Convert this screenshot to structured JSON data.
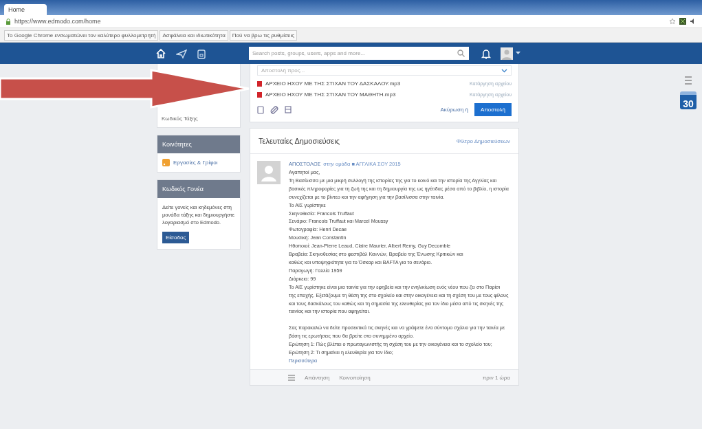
{
  "browser": {
    "tab_title": "Home",
    "address": "https://www.edmodo.com/home",
    "bookmarks": [
      "Το Google Chrome ενσωματώνει τον καλύτερο φυλλομετρητή",
      "Ασφάλεια και ιδιωτικότητα",
      "Πού να βρω τις ρυθμίσεις"
    ]
  },
  "navbar": {
    "search": {
      "placeholder": "Search posts, groups, users, apps and more..."
    }
  },
  "composer": {
    "recipient_placeholder": "Αποστολή προς...",
    "attachments": [
      {
        "name": "ΑΡΧΕΙΟ ΗΧΟΥ ΜΕ ΤΗΣ ΣΤΙΧΑΝ ΤΟΥ ΔΑΣΚΑΛΟΥ.mp3",
        "action": "Κατάργηση αρχείου"
      },
      {
        "name": "ΑΡΧΕΙΟ ΗΧΟΥ ΜΕ ΤΗΣ ΣΤΙΧΑΝ ΤΟΥ ΜΑΘΗΤΗ.mp3",
        "action": "Κατάργηση αρχείου"
      }
    ],
    "cancel": "Ακύρωση ή",
    "send": "Αποστολή"
  },
  "sidebar": {
    "top_item": "Κωδικός Τάξης",
    "sections": [
      {
        "title": "Κοινότητες",
        "link": "Εργασίες & Γρίφοι"
      },
      {
        "title": "Κωδικός Γονέα",
        "text": "Δείτε γονείς και κηδεμόνες στη μονάδα τάξης και δημιουργήστε λογαριασμό στο Edmodo.",
        "button": "Είσοδος"
      }
    ]
  },
  "feed": {
    "title": "Τελευταίες Δημοσιεύσεις",
    "filter": "Φίλτρο Δημοσιεύσεων",
    "post": {
      "author": "ΑΠΟΣΤΟΛΟΣ",
      "meta": "στην ομάδα ■ ΑΓΓΛΙΚΑ ΣΟΥ 2015",
      "paragraphs": [
        [
          "Αγαπητοί μας,",
          "Τη Βασίλισσα με μια μικρή συλλογή της ιστορίας της για το κοινό και την ιστορία της Αγγλίας και",
          "βασικές πληροφορίες για τη ζωή της και τη δημιουργία της ως ηγέτιδας μέσα από το βιβλίο, η ιστορία",
          "συνεχίζεται με το βίντεο και την αφήγηση για την βασίλισσα στην ταινία.",
          "Το ΑΙΣ γυρίστηκε",
          "Σκηνοθεσία: Francois Truffaut",
          "Σενάριο: Francois Truffaut και Marcel Moussy",
          "Φωτογραφία: Henri Decae",
          "Μουσική: Jean Constantin",
          "Ηθοποιοί: Jean-Pierre Leaud, Claire Maurier, Albert Remy, Guy Decomble",
          "Βραβεία: Σκηνοθεσίας στο φεστιβάλ Καννών, Βραβείο της Ένωσης Κριτικών και",
          "καθώς και υποψηφιότητα για το Όσκαρ και BAFTA για το σενάριο.",
          "Παραγωγή: Γαλλία 1959",
          "Διάρκεια: 99",
          "Το ΑΙΣ γυρίστηκε είναι μια ταινία για την εφηβεία και την ενηλικίωση ενός νέου που ζει στο Παρίσι",
          "της εποχής. Εξετάζουμε τη θέση της στο σχολείο και στην οικογένεια και τη σχέση του με τους φίλους",
          "και τους δασκάλους του καθώς και τη σημασία της ελευθερίας για τον ίδιο μέσα από τις σκηνές της",
          "ταινίας και την ιστορία που αφηγείται."
        ],
        [
          "Σας παρακαλώ να δείτε προσεκτικά τις σκηνές και να γράψετε ένα σύντομο σχόλιο για την ταινία με",
          "βάση τις ερωτήσεις που θα βρείτε στο συνημμένο αρχείο.",
          "Ερώτηση 1: Πώς βλέπει ο πρωταγωνιστής τη σχέση του με την οικογένεια και το σχολείο του;",
          "Ερώτηση 2: Τι σημαίνει η ελευθερία για τον ίδιο;"
        ]
      ],
      "read_more": "Περισσότερα",
      "footer": {
        "comment": "Απάντηση",
        "share": "Κοινοποίηση",
        "time": "πριν 1 ώρα"
      }
    }
  },
  "right_rail": {
    "calendar_day": "30"
  }
}
